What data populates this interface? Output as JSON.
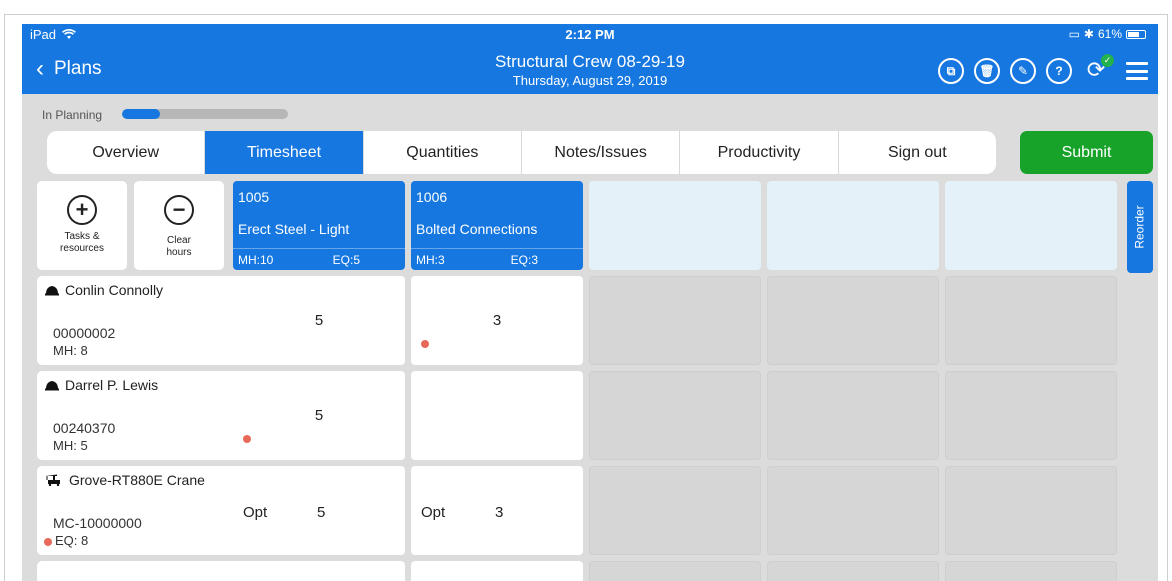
{
  "status_bar": {
    "carrier": "iPad",
    "time": "2:12 PM",
    "battery": "61%"
  },
  "header": {
    "back_label": "Plans",
    "title": "Structural Crew 08-29-19",
    "subtitle": "Thursday, August 29, 2019",
    "icons": [
      "copy-icon",
      "trash-icon",
      "edit-icon",
      "help-icon",
      "sync-icon",
      "menu-icon"
    ],
    "accent": "#1577df"
  },
  "progress": {
    "label": "In Planning",
    "value": 0.23
  },
  "tabs": [
    {
      "label": "Overview"
    },
    {
      "label": "Timesheet",
      "active": true
    },
    {
      "label": "Quantities"
    },
    {
      "label": "Notes/Issues"
    },
    {
      "label": "Productivity"
    },
    {
      "label": "Sign out"
    }
  ],
  "submit_label": "Submit",
  "tools": {
    "add": {
      "label1": "Tasks &",
      "label2": "resources"
    },
    "clear": {
      "label1": "Clear",
      "label2": "hours"
    }
  },
  "tasks": [
    {
      "code": "1005",
      "name": "Erect Steel - Light",
      "mh": "MH:10",
      "eq": "EQ:5"
    },
    {
      "code": "1006",
      "name": "Bolted Connections",
      "mh": "MH:3",
      "eq": "EQ:3"
    }
  ],
  "reorder_label": "Reorder",
  "resources": [
    {
      "name": "Conlin Connolly",
      "id": "00000002",
      "hours": "MH: 8",
      "icon": "hardhat-icon"
    },
    {
      "name": "Darrel P. Lewis",
      "id": "00240370",
      "hours": "MH: 5",
      "icon": "hardhat-icon"
    },
    {
      "name": "Grove-RT880E Crane",
      "id": "MC-10000000",
      "hours": "EQ:  8",
      "icon": "crane-icon"
    }
  ],
  "cells": [
    [
      "5",
      "3"
    ],
    [
      "5",
      ""
    ],
    [
      "5",
      "3"
    ]
  ],
  "opt_label": "Opt"
}
